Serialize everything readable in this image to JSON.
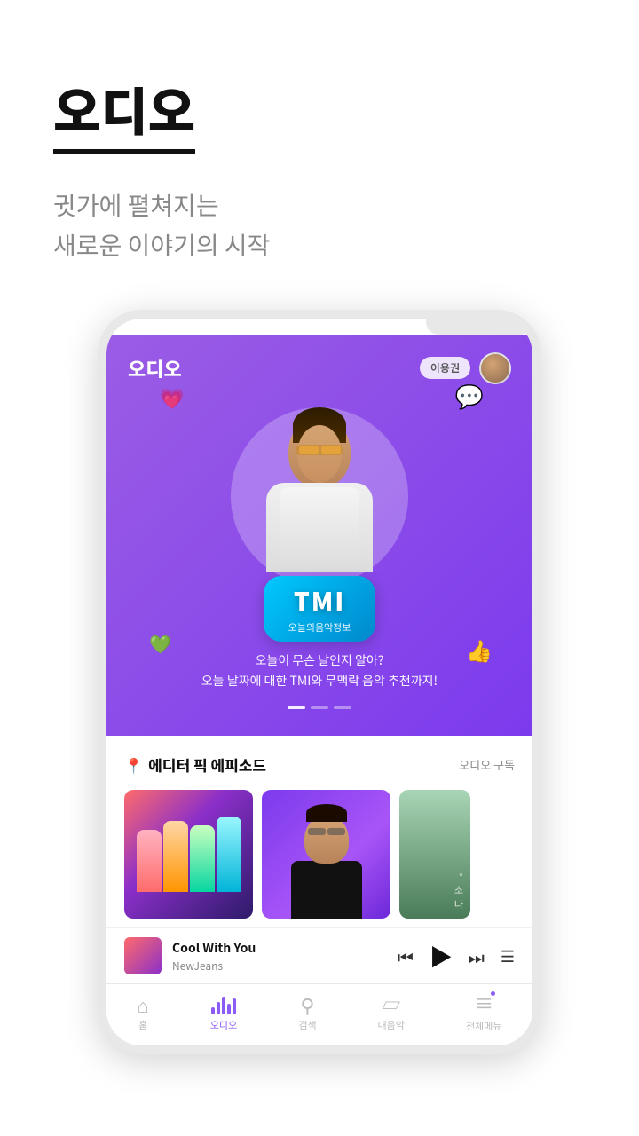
{
  "header": {
    "title": "오디오",
    "subtitle_line1": "귓가에 펼쳐지는",
    "subtitle_line2": "새로운 이야기의 시작"
  },
  "app": {
    "logo": "오디오",
    "user_badge": "이용권",
    "banner": {
      "tmi_main": "TMI",
      "tmi_sub": "오늘의음악정보",
      "desc_line1": "오늘이 무슨 날인지 알아?",
      "desc_line2": "오늘 날짜에 대한 TMI와 무맥락 음악 추천까지!"
    },
    "section": {
      "icon": "📍",
      "title": "에디터 픽 에피소드",
      "link": "오디오 구독"
    },
    "player": {
      "title": "Cool With You",
      "artist": "NewJeans"
    },
    "bottom_nav": [
      {
        "icon": "home",
        "label": "홈",
        "active": false
      },
      {
        "icon": "audio",
        "label": "오디오",
        "active": true
      },
      {
        "icon": "search",
        "label": "검색",
        "active": false
      },
      {
        "icon": "folder",
        "label": "내음악",
        "active": false
      },
      {
        "icon": "menu",
        "label": "전체메뉴",
        "active": false
      }
    ]
  }
}
